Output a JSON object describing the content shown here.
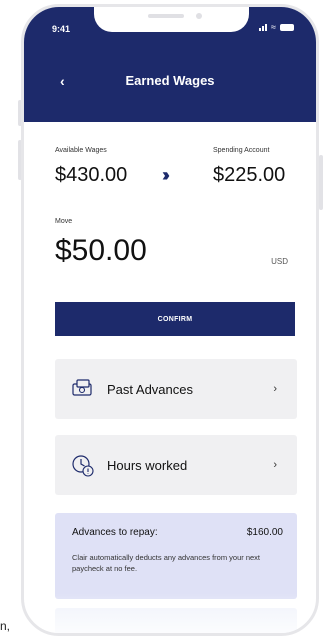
{
  "status_bar": {
    "time": "9:41"
  },
  "header": {
    "title": "Earned Wages"
  },
  "wages": {
    "available_label": "Available Wages",
    "available_value": "$430.00",
    "spending_label": "Spending Account",
    "spending_value": "$225.00"
  },
  "move": {
    "label": "Move",
    "amount": "$50.00",
    "currency": "USD"
  },
  "confirm_label": "CONFIRM",
  "cards": [
    {
      "label": "Past Advances"
    },
    {
      "label": "Hours worked"
    }
  ],
  "repay": {
    "title": "Advances to repay:",
    "amount": "$160.00",
    "note": "Clair automatically deducts any advances from your next paycheck at no fee."
  },
  "edge_text": "n,",
  "colors": {
    "brand": "#1d2a6b",
    "card": "#f0f0f2",
    "repay": "#dfe1f6"
  },
  "icons": [
    "back-icon",
    "double-chevron-icon",
    "money-stack-icon",
    "clock-icon",
    "chevron-right-icon",
    "signal-icon",
    "wifi-icon",
    "battery-icon"
  ]
}
